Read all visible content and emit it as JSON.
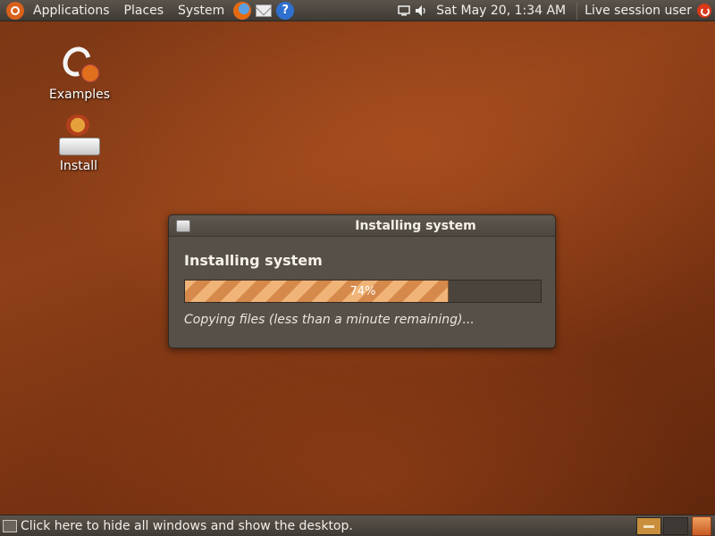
{
  "top_panel": {
    "menus": [
      "Applications",
      "Places",
      "System"
    ],
    "launchers": [
      "firefox-icon",
      "mail-icon",
      "help-icon"
    ],
    "help_glyph": "?",
    "clock": "Sat May 20,  1:34 AM",
    "user": "Live session user"
  },
  "desktop": {
    "icons": [
      {
        "label": "Examples",
        "icon": "examples-icon"
      },
      {
        "label": "Install",
        "icon": "install-icon"
      }
    ]
  },
  "dialog": {
    "title": "Installing system",
    "heading": "Installing system",
    "progress_percent": 74,
    "progress_text": "74%",
    "status": "Copying files (less than a minute remaining)..."
  },
  "bottom_panel": {
    "show_desktop": "Click here to hide all windows and show the desktop."
  },
  "colors": {
    "accent_orange": "#d8611b",
    "panel": "#4a453e",
    "dialog_bg": "#575048",
    "progress_stripe_light": "#f0b478",
    "progress_stripe_dark": "#d5894a"
  }
}
